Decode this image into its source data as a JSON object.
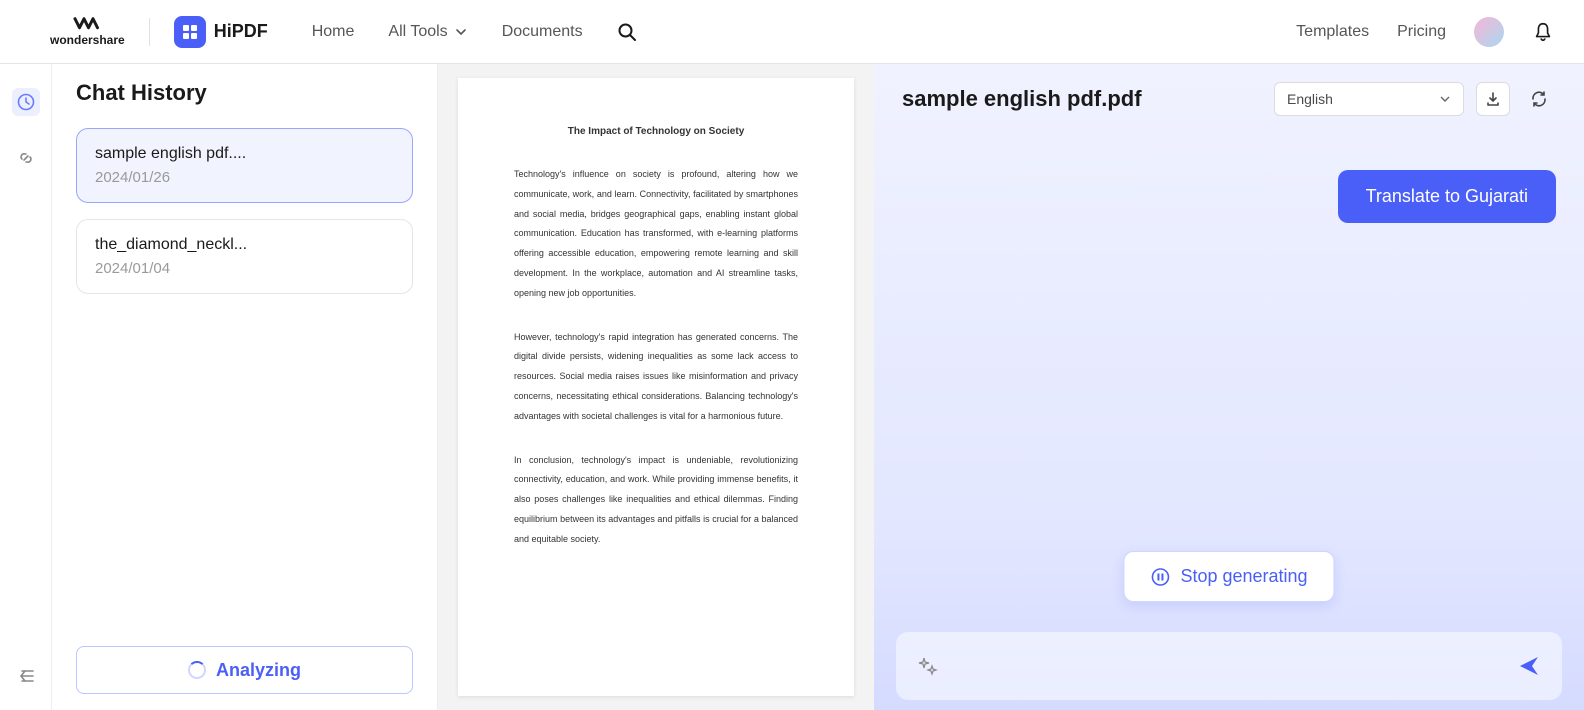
{
  "header": {
    "brand_text": "wondershare",
    "product_text": "HiPDF",
    "nav": {
      "home": "Home",
      "all_tools": "All Tools",
      "documents": "Documents",
      "templates": "Templates",
      "pricing": "Pricing"
    }
  },
  "sidebar": {
    "title": "Chat History",
    "items": [
      {
        "name": "sample english pdf....",
        "date": "2024/01/26"
      },
      {
        "name": "the_diamond_neckl...",
        "date": "2024/01/04"
      }
    ],
    "analyze_label": "Analyzing"
  },
  "document": {
    "title": "The Impact of Technology on Society",
    "paragraphs": [
      "Technology's influence on society is profound, altering how we communicate, work, and learn. Connectivity, facilitated by smartphones and social media, bridges geographical gaps, enabling instant global communication. Education has transformed, with e-learning platforms offering accessible education, empowering remote learning and skill development. In the workplace, automation and AI streamline tasks, opening new job opportunities.",
      "However, technology's rapid integration has generated concerns. The digital divide persists, widening inequalities as some lack access to resources. Social media raises issues like misinformation and privacy concerns, necessitating ethical considerations. Balancing technology's advantages with societal challenges is vital for a harmonious future.",
      "In conclusion, technology's impact is undeniable, revolutionizing connectivity, education, and work. While providing immense benefits, it also poses challenges like inequalities and ethical dilemmas. Finding equilibrium between its advantages and pitfalls is crucial for a balanced and equitable society."
    ]
  },
  "chat": {
    "file_title": "sample english pdf.pdf",
    "language_selected": "English",
    "user_message": "Translate to Gujarati",
    "stop_label": "Stop generating",
    "input_placeholder": ""
  }
}
